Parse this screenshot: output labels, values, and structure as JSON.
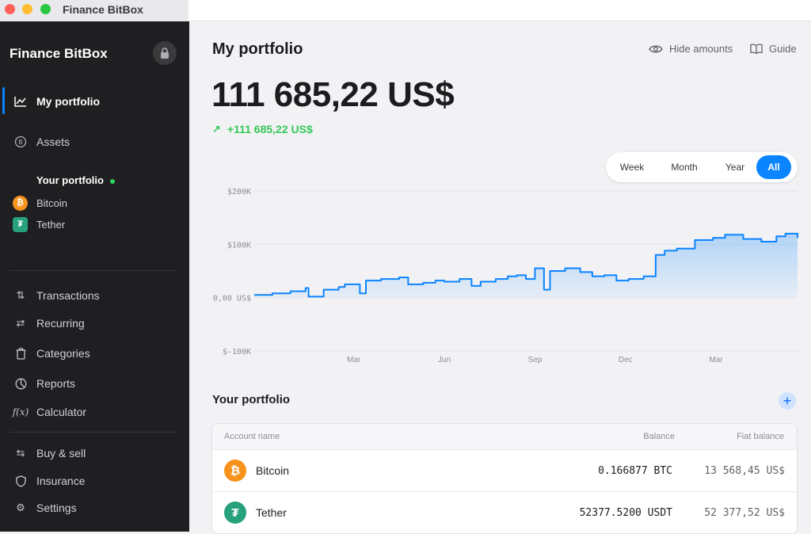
{
  "window": {
    "title": "Finance BitBox"
  },
  "sidebar": {
    "brand": "Finance BitBox",
    "primary": [
      {
        "label": "My portfolio",
        "icon": "chart-line-icon",
        "active": true
      },
      {
        "label": "Assets",
        "icon": "bitcoin-circle-icon",
        "active": false
      }
    ],
    "portfolio_section": {
      "title": "Your portfolio",
      "coins": [
        {
          "label": "Bitcoin",
          "icon": "bitcoin-icon",
          "color": "#f7931a"
        },
        {
          "label": "Tether",
          "icon": "tether-icon",
          "color": "#26a17b"
        }
      ]
    },
    "tools": [
      {
        "label": "Transactions",
        "icon": "arrows-updown-icon"
      },
      {
        "label": "Recurring",
        "icon": "repeat-icon"
      },
      {
        "label": "Categories",
        "icon": "trash-icon"
      },
      {
        "label": "Reports",
        "icon": "pie-chart-icon"
      },
      {
        "label": "Calculator",
        "icon": "function-icon"
      }
    ],
    "footer": [
      {
        "label": "Buy & sell",
        "icon": "exchange-icon"
      },
      {
        "label": "Insurance",
        "icon": "shield-icon"
      },
      {
        "label": "Settings",
        "icon": "gear-icon"
      }
    ]
  },
  "main": {
    "title": "My portfolio",
    "actions": {
      "hide_amounts": "Hide amounts",
      "guide": "Guide"
    },
    "total": "111 685,22 US$",
    "delta": "+111 685,22 US$",
    "ranges": [
      {
        "label": "Week",
        "selected": false
      },
      {
        "label": "Month",
        "selected": false
      },
      {
        "label": "Year",
        "selected": false
      },
      {
        "label": "All",
        "selected": true
      }
    ],
    "portfolio_title": "Your portfolio",
    "table": {
      "headers": {
        "account": "Account name",
        "balance": "Balance",
        "fiat": "Fiat balance"
      },
      "rows": [
        {
          "name": "Bitcoin",
          "balance": "0.166877 BTC",
          "fiat": "13 568,45 US$",
          "color": "#f7931a",
          "icon": "bitcoin-icon"
        },
        {
          "name": "Tether",
          "balance": "52377.5200 USDT",
          "fiat": "52 377,52 US$",
          "color": "#26a17b",
          "icon": "tether-icon"
        }
      ]
    }
  },
  "chart_data": {
    "type": "area",
    "ytick_labels": [
      "$200K",
      "$100K",
      "0,00 US$",
      "$-100K"
    ],
    "yticks": [
      200000,
      100000,
      0,
      -100000
    ],
    "ylim": [
      -100000,
      200000
    ],
    "xtick_labels": [
      "Mar",
      "Jun",
      "Sep",
      "Dec",
      "Mar"
    ],
    "xtick_positions": [
      3.3,
      6.3,
      9.3,
      12.3,
      15.3
    ],
    "xlim": [
      0,
      18
    ],
    "grid": true,
    "color": "#0a84ff",
    "series": [
      {
        "x": [
          0,
          0.6,
          1.2,
          1.7,
          1.8,
          2.3,
          2.8,
          3.0,
          3.5,
          3.7,
          4.2,
          4.8,
          5.1,
          5.6,
          6.0,
          6.3,
          6.8,
          7.2,
          7.5,
          8.0,
          8.4,
          8.7,
          9.0,
          9.3,
          9.6,
          9.8,
          10.3,
          10.8,
          11.2,
          11.6,
          12.0,
          12.4,
          12.9,
          13.3,
          13.6,
          14.0,
          14.6,
          15.2,
          15.6,
          16.2,
          16.8,
          17.3,
          17.6,
          18.0
        ],
        "y": [
          5000,
          8000,
          12000,
          18000,
          2000,
          15000,
          20000,
          25000,
          8000,
          32000,
          35000,
          38000,
          25000,
          28000,
          32000,
          30000,
          35000,
          22000,
          30000,
          35000,
          40000,
          42000,
          35000,
          55000,
          15000,
          50000,
          55000,
          48000,
          40000,
          42000,
          32000,
          35000,
          40000,
          80000,
          88000,
          92000,
          108000,
          112000,
          118000,
          110000,
          105000,
          115000,
          120000,
          112000
        ]
      }
    ]
  }
}
